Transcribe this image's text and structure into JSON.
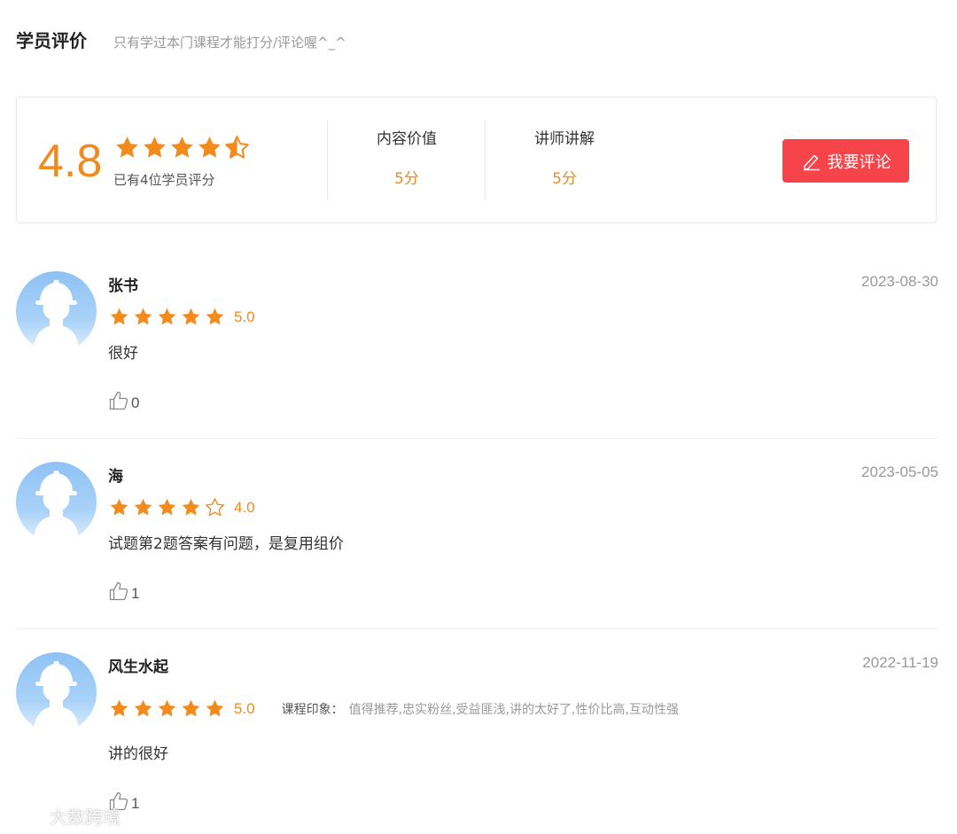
{
  "header": {
    "title": "学员评价",
    "subtitle": "只有学过本门课程才能打分/评论喔^_^"
  },
  "summary": {
    "overall_score": "4.8",
    "overall_stars": 4.5,
    "rating_count_text": "已有4位学员评分",
    "metrics": [
      {
        "label": "内容价值",
        "value": "5分"
      },
      {
        "label": "讲师讲解",
        "value": "5分"
      }
    ],
    "comment_button_label": "我要评论"
  },
  "reviews": [
    {
      "name": "张书",
      "date": "2023-08-30",
      "stars": 5,
      "score": "5.0",
      "text": "很好",
      "likes": "0"
    },
    {
      "name": "海",
      "date": "2023-05-05",
      "stars": 4,
      "score": "4.0",
      "text": "试题第2题答案有问题，是复用组价",
      "likes": "1"
    },
    {
      "name": "风生水起",
      "date": "2022-11-19",
      "stars": 5,
      "score": "5.0",
      "impression_label": "课程印象：",
      "impression_tags": "值得推荐,忠实粉丝,受益匪浅,讲的太好了,性价比高,互动性强",
      "text": "讲的很好",
      "likes": "1"
    }
  ],
  "watermark": {
    "text": "大数跨境"
  },
  "colors": {
    "accent_orange": "#f28a1c",
    "button_red": "#f6444a",
    "text_gray": "#999999"
  },
  "icons": {
    "star": "star-icon",
    "half_star": "half-star-icon",
    "empty_star": "empty-star-icon",
    "edit": "edit-icon",
    "thumbs_up": "thumbs-up-icon",
    "avatar": "default-avatar-icon"
  }
}
